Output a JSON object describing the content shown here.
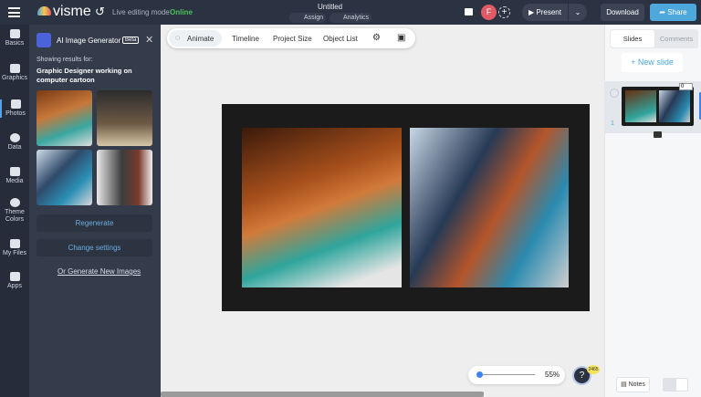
{
  "header": {
    "brand": "visme",
    "live_mode": "Live editing mode",
    "status": "Online",
    "title": "Untitled",
    "assign": "Assign",
    "analytics": "Analytics",
    "avatar": "F",
    "present": "Present",
    "download": "Download",
    "share": "Share"
  },
  "rail": [
    {
      "label": "Basics"
    },
    {
      "label": "Graphics"
    },
    {
      "label": "Photos"
    },
    {
      "label": "Data"
    },
    {
      "label": "Media"
    },
    {
      "label": "Theme Colors"
    },
    {
      "label": "My Files"
    },
    {
      "label": "Apps"
    }
  ],
  "panel": {
    "title": "AI Image Generator",
    "badge": "Beta",
    "showing": "Showing results for:",
    "query": "Graphic Designer working on computer cartoon",
    "regenerate": "Regenerate",
    "change_settings": "Change settings",
    "generate_new": "Or Generate New Images"
  },
  "toolbar": {
    "animate": "Animate",
    "timeline": "Timeline",
    "project_size": "Project Size",
    "object_list": "Object List"
  },
  "right": {
    "tab_slides": "Slides",
    "tab_comments": "Comments",
    "new_slide": "+ New slide",
    "slide_number": "1",
    "slide_duration": "0",
    "notes": "Notes"
  },
  "zoom": {
    "value": "55%",
    "fraction": 0.1
  },
  "help": {
    "label": "?",
    "badge": "2465"
  },
  "colors": {
    "accent": "#5aa0e6",
    "online": "#4cc25a",
    "avatar": "#e05a66"
  }
}
